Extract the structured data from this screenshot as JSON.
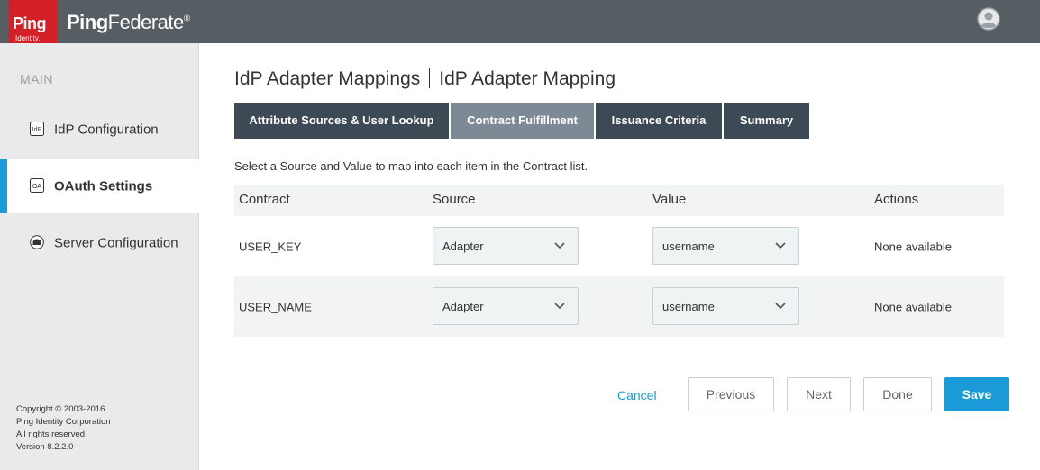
{
  "header": {
    "logo_ping": "Ping",
    "logo_identity": "Identity.",
    "brand_ping": "Ping",
    "brand_rest": "Federate",
    "brand_mark": "®",
    "avatar_icon": "user-avatar-icon"
  },
  "sidebar": {
    "section_label": "MAIN",
    "items": [
      {
        "label": "IdP Configuration",
        "icon": "idp-icon"
      },
      {
        "label": "OAuth Settings",
        "icon": "oa-icon"
      },
      {
        "label": "Server Configuration",
        "icon": "server-icon"
      }
    ],
    "active_index": 1,
    "footer": [
      "Copyright © 2003-2016",
      "Ping Identity Corporation",
      "All rights reserved",
      "Version 8.2.2.0"
    ]
  },
  "main": {
    "breadcrumb_parent": "IdP Adapter Mappings",
    "breadcrumb_current": "IdP Adapter Mapping",
    "tabs": [
      {
        "label": "Attribute Sources & User Lookup"
      },
      {
        "label": "Contract Fulfillment"
      },
      {
        "label": "Issuance Criteria"
      },
      {
        "label": "Summary"
      }
    ],
    "active_tab": 1,
    "instruction": "Select a Source and Value to map into each item in the Contract list.",
    "table": {
      "headers": [
        "Contract",
        "Source",
        "Value",
        "Actions"
      ],
      "rows": [
        {
          "contract": "USER_KEY",
          "source": "Adapter",
          "value": "username",
          "actions": "None available"
        },
        {
          "contract": "USER_NAME",
          "source": "Adapter",
          "value": "username",
          "actions": "None available"
        }
      ]
    },
    "buttons": {
      "cancel": "Cancel",
      "previous": "Previous",
      "next": "Next",
      "done": "Done",
      "save": "Save"
    }
  },
  "colors": {
    "accent": "#1a9ad6",
    "header_bg": "#575e63",
    "tab_bg": "#3d4a55",
    "tab_active_bg": "#7d8a96",
    "logo_red": "#d31f26"
  }
}
